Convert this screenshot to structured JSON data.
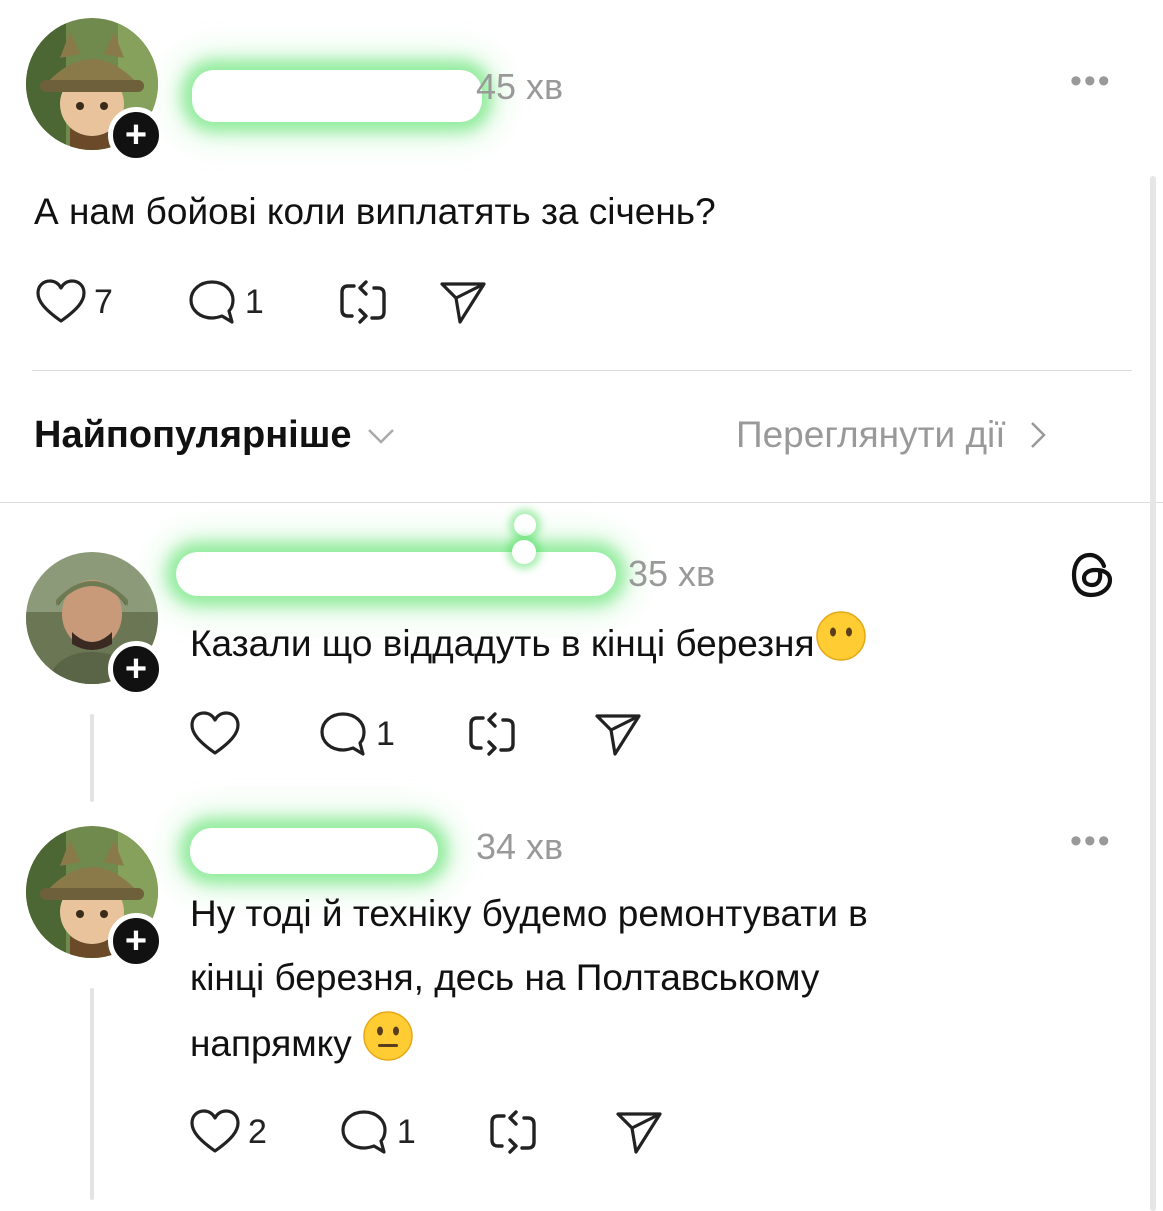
{
  "post": {
    "time": "45 хв",
    "text": "А нам бойові коли виплатять за січень?",
    "likes": "7",
    "replies": "1"
  },
  "sort": {
    "label": "Найпопулярніше",
    "view_activity": "Переглянути дії"
  },
  "replies": [
    {
      "time": "35 хв",
      "text": "Казали що віддадуть в кінці березня",
      "likes": "",
      "replies": "1"
    },
    {
      "time": "34 хв",
      "text_line1": "Ну тоді й техніку будемо ремонтувати в",
      "text_line2": "кінці березня, десь на Полтавському",
      "text_line3": "напрямку",
      "likes": "2",
      "replies": "1"
    }
  ],
  "icons": {
    "more": "more-icon",
    "like": "heart-icon",
    "reply": "comment-icon",
    "repost": "repost-icon",
    "share": "send-icon",
    "threads": "threads-logo-icon"
  },
  "colors": {
    "highlight": "#3cdc50",
    "muted": "#999999"
  }
}
